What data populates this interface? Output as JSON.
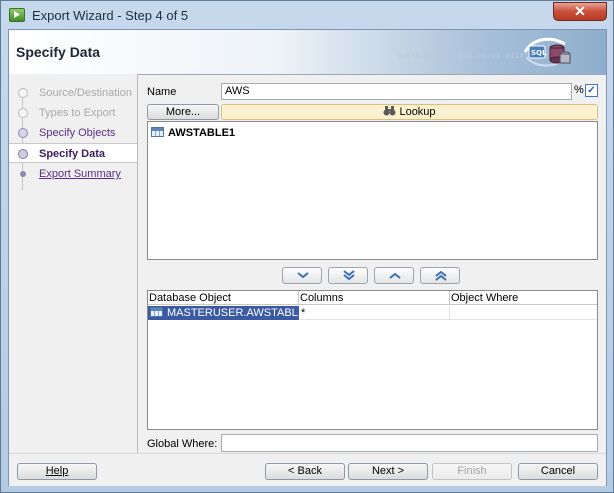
{
  "window": {
    "title": "Export Wizard - Step 4 of 5",
    "close_glyph": "✕"
  },
  "banner": {
    "title": "Specify Data",
    "binary_text": "0101010110101010100101 011010010 0110",
    "icon": "database-export-icon"
  },
  "steps": [
    {
      "label": "Source/Destination",
      "state": "done"
    },
    {
      "label": "Types to Export",
      "state": "done"
    },
    {
      "label": "Specify Objects",
      "state": "link"
    },
    {
      "label": "Specify Data",
      "state": "active"
    },
    {
      "label": "Export Summary",
      "state": "next"
    }
  ],
  "filter": {
    "name_label": "Name",
    "name_value": "AWS",
    "wildcard": "%",
    "auto_query_checked": true,
    "more_label": "More...",
    "lookup_label": "Lookup",
    "lookup_icon": "binoculars-icon"
  },
  "available": {
    "items": [
      {
        "label": "AWSTABLE1",
        "icon": "table-icon"
      }
    ]
  },
  "move_buttons": [
    "move-down-icon",
    "move-all-down-icon",
    "move-up-icon",
    "move-all-up-icon"
  ],
  "selected_table": {
    "columns": [
      "Database Object",
      "Columns",
      "Object Where"
    ],
    "rows": [
      {
        "object": "MASTERUSER.AWSTABL...",
        "columns": "*",
        "where": ""
      }
    ]
  },
  "global_where": {
    "label": "Global Where:",
    "value": ""
  },
  "buttons": {
    "help": "Help",
    "back": "< Back",
    "next": "Next >",
    "finish": "Finish",
    "cancel": "Cancel"
  },
  "colors": {
    "accent": "#5a2d87",
    "selection": "#3b5aa3",
    "lookup_bg": "#fbf1d0"
  }
}
